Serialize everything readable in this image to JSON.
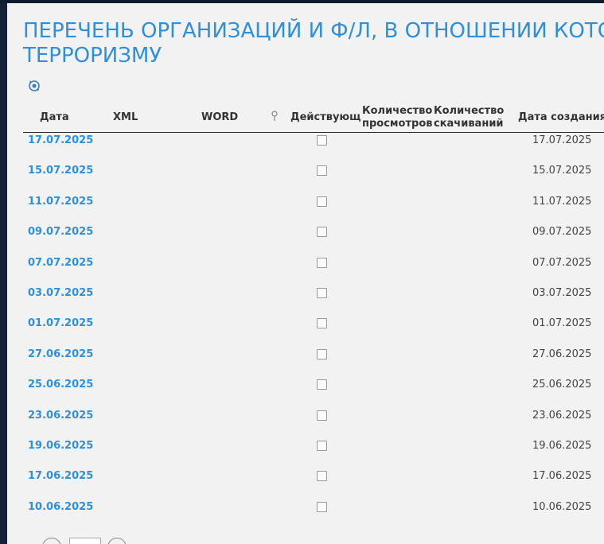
{
  "page": {
    "title_line1": "ПЕРЕЧЕНЬ ОРГАНИЗАЦИЙ И Ф/Л, В ОТНОШЕНИИ КОТО",
    "title_line2": "ТЕРРОРИЗМУ",
    "title_color": "#2f8fd8"
  },
  "toolbar": {
    "refresh_icon": "refresh-icon"
  },
  "table": {
    "headers": {
      "date": "Дата",
      "xml": "XML",
      "word": "WORD",
      "active": "Действующ",
      "views_1": "Количество",
      "views_2": "просмотров",
      "downloads_1": "Количество",
      "downloads_2": "скачиваний",
      "created": "Дата создания"
    },
    "rows": [
      {
        "date": "17.07.2025",
        "active": false,
        "created": "17.07.2025"
      },
      {
        "date": "15.07.2025",
        "active": false,
        "created": "15.07.2025"
      },
      {
        "date": "11.07.2025",
        "active": false,
        "created": "11.07.2025"
      },
      {
        "date": "09.07.2025",
        "active": false,
        "created": "09.07.2025"
      },
      {
        "date": "07.07.2025",
        "active": false,
        "created": "07.07.2025"
      },
      {
        "date": "03.07.2025",
        "active": false,
        "created": "03.07.2025"
      },
      {
        "date": "01.07.2025",
        "active": false,
        "created": "01.07.2025"
      },
      {
        "date": "27.06.2025",
        "active": false,
        "created": "27.06.2025"
      },
      {
        "date": "25.06.2025",
        "active": false,
        "created": "25.06.2025"
      },
      {
        "date": "23.06.2025",
        "active": false,
        "created": "23.06.2025"
      },
      {
        "date": "19.06.2025",
        "active": false,
        "created": "19.06.2025"
      },
      {
        "date": "17.06.2025",
        "active": false,
        "created": "17.06.2025"
      },
      {
        "date": "10.06.2025",
        "active": false,
        "created": "10.06.2025"
      }
    ]
  },
  "pager": {
    "prev_icon": "chevron-left-icon",
    "next_icon": "chevron-right-icon"
  }
}
